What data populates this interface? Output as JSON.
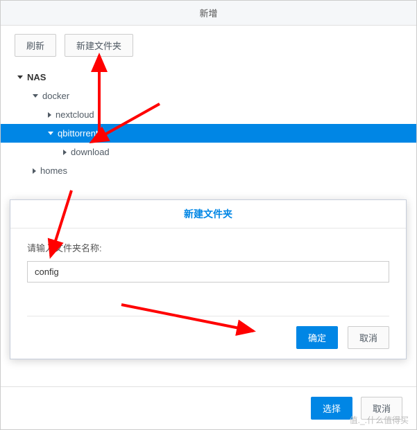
{
  "main": {
    "title": "新增",
    "toolbar": {
      "refresh_label": "刷新",
      "new_folder_label": "新建文件夹"
    },
    "tree": {
      "root": "NAS",
      "nodes": [
        {
          "label": "docker",
          "expanded": true,
          "depth": 1
        },
        {
          "label": "nextcloud",
          "expanded": false,
          "depth": 2
        },
        {
          "label": "qbittorrent",
          "expanded": true,
          "depth": 2,
          "selected": true
        },
        {
          "label": "download",
          "expanded": false,
          "depth": 3
        },
        {
          "label": "homes",
          "expanded": false,
          "depth": 1
        }
      ]
    },
    "footer": {
      "select_label": "选择",
      "cancel_label": "取消"
    }
  },
  "inner": {
    "title": "新建文件夹",
    "prompt": "请输入文件夹名称:",
    "value": "config",
    "ok_label": "确定",
    "cancel_label": "取消"
  },
  "watermark": "值._.什么值得买",
  "colors": {
    "primary": "#0086E5",
    "annotation": "#FF0000"
  }
}
